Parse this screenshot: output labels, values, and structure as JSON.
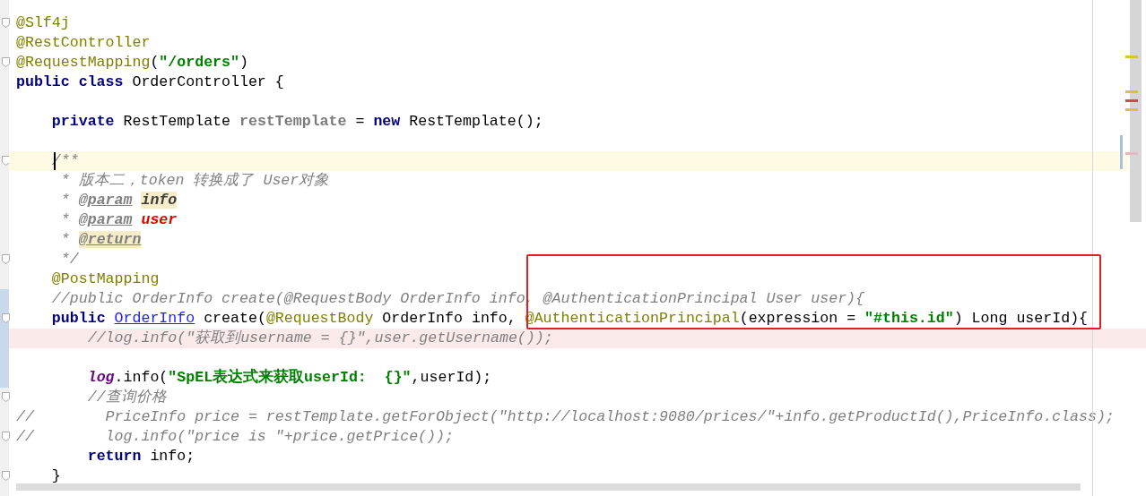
{
  "editor": {
    "lines": [
      {
        "kind": "code",
        "fold": true,
        "tokens": [
          {
            "t": "@Slf4j",
            "kind": "ann"
          }
        ]
      },
      {
        "kind": "code",
        "tokens": [
          {
            "t": "@RestController",
            "kind": "ann"
          }
        ]
      },
      {
        "kind": "code",
        "fold": true,
        "tokens": [
          {
            "t": "@RequestMapping",
            "kind": "ann"
          },
          {
            "t": "(",
            "kind": "plain"
          },
          {
            "t": "\"/orders\"",
            "kind": "str"
          },
          {
            "t": ")",
            "kind": "plain"
          }
        ]
      },
      {
        "kind": "code",
        "tokens": [
          {
            "t": "public class ",
            "kind": "kw"
          },
          {
            "t": "OrderController {",
            "kind": "plain"
          }
        ]
      },
      {
        "kind": "blank"
      },
      {
        "kind": "code",
        "tokens": [
          {
            "t": "    private",
            "kind": "kw"
          },
          {
            "t": " RestTemplate ",
            "kind": "plain"
          },
          {
            "t": "restTemplate",
            "kind": "field"
          },
          {
            "t": " = ",
            "kind": "plain"
          },
          {
            "t": "new",
            "kind": "kw"
          },
          {
            "t": " RestTemplate();",
            "kind": "plain"
          }
        ]
      },
      {
        "kind": "blank"
      },
      {
        "kind": "code",
        "fold": true,
        "current_line": true,
        "caret": true,
        "tokens": [
          {
            "t": "    /**",
            "kind": "comment"
          }
        ]
      },
      {
        "kind": "code",
        "tokens": [
          {
            "t": "     * 版本二，token 转换成了 User对象",
            "kind": "comment"
          }
        ]
      },
      {
        "kind": "code",
        "tokens": [
          {
            "t": "     * ",
            "kind": "comment"
          },
          {
            "t": "@param",
            "kind": "doctag"
          },
          {
            "t": " info",
            "kind": "docparam",
            "marked": true
          }
        ]
      },
      {
        "kind": "code",
        "tokens": [
          {
            "t": "     * ",
            "kind": "comment"
          },
          {
            "t": "@param",
            "kind": "doctag"
          },
          {
            "t": " user",
            "kind": "badparam"
          }
        ]
      },
      {
        "kind": "code",
        "tokens": [
          {
            "t": "     * ",
            "kind": "comment"
          },
          {
            "t": "@return",
            "kind": "doctag",
            "marked": true
          }
        ]
      },
      {
        "kind": "code",
        "fold": true,
        "tokens": [
          {
            "t": "     */",
            "kind": "comment"
          }
        ]
      },
      {
        "kind": "code",
        "tokens": [
          {
            "t": "    @PostMapping",
            "kind": "ann"
          }
        ]
      },
      {
        "kind": "code",
        "changed": true,
        "tokens": [
          {
            "t": "    //public OrderInfo create(@RequestBody OrderInfo info, @AuthenticationPrincipal User user){",
            "kind": "comment"
          }
        ]
      },
      {
        "kind": "code",
        "changed": true,
        "fold": true,
        "tokens": [
          {
            "t": "    public ",
            "kind": "kw"
          },
          {
            "t": "OrderInfo",
            "kind": "link"
          },
          {
            "t": " create(",
            "kind": "plain"
          },
          {
            "t": "@RequestBody",
            "kind": "ann"
          },
          {
            "t": " OrderInfo info, ",
            "kind": "plain"
          },
          {
            "t": "@AuthenticationPrincipal",
            "kind": "ann"
          },
          {
            "t": "(expression = ",
            "kind": "plain"
          },
          {
            "t": "\"#this.id\"",
            "kind": "str"
          },
          {
            "t": ") Long userId){",
            "kind": "plain"
          }
        ]
      },
      {
        "kind": "code",
        "changed": true,
        "error_line": true,
        "tokens": [
          {
            "t": "        //log.info(\"获取到username = {}\",user.getUsername());",
            "kind": "comment"
          }
        ]
      },
      {
        "kind": "blank",
        "changed": true
      },
      {
        "kind": "code",
        "changed": true,
        "tokens": [
          {
            "t": "        log",
            "kind": "logfield"
          },
          {
            "t": ".info(",
            "kind": "plain"
          },
          {
            "t": "\"SpEL表达式来获取userId:  {}\"",
            "kind": "str"
          },
          {
            "t": ",userId);",
            "kind": "plain"
          }
        ]
      },
      {
        "kind": "code",
        "fold": true,
        "tokens": [
          {
            "t": "        //查询价格",
            "kind": "comment"
          }
        ]
      },
      {
        "kind": "code",
        "tokens": [
          {
            "t": "//        PriceInfo price = restTemplate.getForObject(\"http://localhost:9080/prices/\"+info.getProductId(),PriceInfo.class);",
            "kind": "comment"
          }
        ]
      },
      {
        "kind": "code",
        "fold": true,
        "tokens": [
          {
            "t": "//        log.info(\"price is \"+price.getPrice());",
            "kind": "comment"
          }
        ]
      },
      {
        "kind": "code",
        "tokens": [
          {
            "t": "        return",
            "kind": "kw"
          },
          {
            "t": " info;",
            "kind": "plain"
          }
        ]
      },
      {
        "kind": "code",
        "fold": true,
        "tokens": [
          {
            "t": "    }",
            "kind": "plain"
          }
        ]
      }
    ]
  }
}
